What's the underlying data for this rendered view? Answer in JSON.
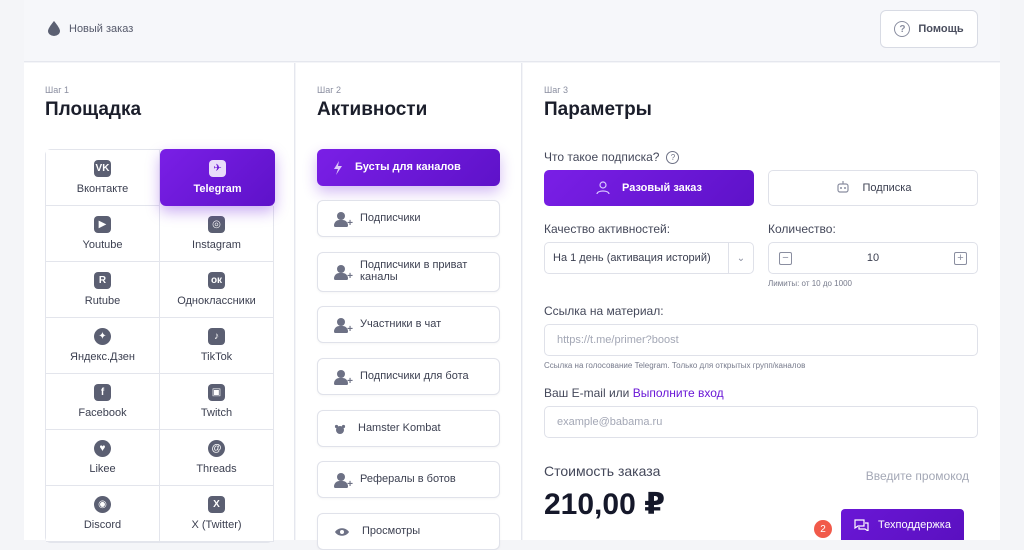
{
  "header": {
    "title": "Новый заказ",
    "help_label": "Помощь"
  },
  "step1": {
    "step_label": "Шаг 1",
    "title": "Площадка",
    "platforms": [
      {
        "label": "Вконтакте",
        "glyph": "VK",
        "icon": "vk-icon"
      },
      {
        "label": "Telegram",
        "glyph": "✈",
        "icon": "telegram-icon",
        "selected": true
      },
      {
        "label": "Youtube",
        "glyph": "▶",
        "icon": "youtube-icon"
      },
      {
        "label": "Instagram",
        "glyph": "◎",
        "icon": "instagram-icon"
      },
      {
        "label": "Rutube",
        "glyph": "R",
        "icon": "rutube-icon"
      },
      {
        "label": "Одноклассники",
        "glyph": "ок",
        "icon": "odnoklassniki-icon"
      },
      {
        "label": "Яндекс.Дзен",
        "glyph": "✦",
        "icon": "dzen-icon"
      },
      {
        "label": "TikTok",
        "glyph": "♪",
        "icon": "tiktok-icon"
      },
      {
        "label": "Facebook",
        "glyph": "f",
        "icon": "facebook-icon"
      },
      {
        "label": "Twitch",
        "glyph": "▣",
        "icon": "twitch-icon"
      },
      {
        "label": "Likee",
        "glyph": "♥",
        "icon": "likee-icon"
      },
      {
        "label": "Threads",
        "glyph": "@",
        "icon": "threads-icon"
      },
      {
        "label": "Discord",
        "glyph": "◉",
        "icon": "discord-icon"
      },
      {
        "label": "X (Twitter)",
        "glyph": "X",
        "icon": "x-twitter-icon"
      }
    ]
  },
  "step2": {
    "step_label": "Шаг 2",
    "title": "Активности",
    "activities": [
      {
        "label": "Бусты для каналов",
        "selected": true
      },
      {
        "label": "Подписчики"
      },
      {
        "label": "Подписчики в приват каналы"
      },
      {
        "label": "Участники в чат"
      },
      {
        "label": "Подписчики для бота"
      },
      {
        "label": "Hamster Kombat"
      },
      {
        "label": "Рефералы в ботов"
      },
      {
        "label": "Просмотры"
      }
    ]
  },
  "step3": {
    "step_label": "Шаг 3",
    "title": "Параметры",
    "subscription_question": "Что такое подписка?",
    "order_type_once": "Разовый заказ",
    "order_type_subscription": "Подписка",
    "quality_label": "Качество активностей:",
    "quality_value": "На 1 день (активация историй)",
    "quantity_label": "Количество:",
    "quantity_value": "10",
    "quantity_hint": "Лимиты: от 10 до 1000",
    "link_label": "Ссылка на материал:",
    "link_placeholder": "https://t.me/primer?boost",
    "link_hint": "Ссылка на голосование Telegram. Только для открытых групп/каналов",
    "email_label": "Ваш E-mail или",
    "login_link": "Выполните вход",
    "email_placeholder": "example@babama.ru",
    "price_label": "Стоимость заказа",
    "promo_label": "Введите промокод",
    "price": "210,00 ₽"
  },
  "support": {
    "label": "Техподдержка",
    "badge_count": "2"
  },
  "colors": {
    "accent": "#6a17d6",
    "badge": "#f15a4a"
  }
}
